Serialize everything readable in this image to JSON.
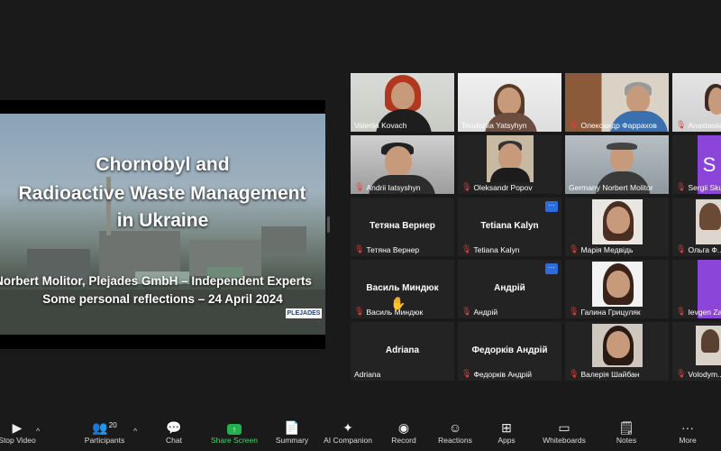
{
  "slide": {
    "title_l1": "Chornobyl and",
    "title_l2": "Radioactive Waste Management",
    "title_l3": "in Ukraine",
    "sub_1": "Norbert Molitor, Plejades GmbH – Independent Experts",
    "sub_2": "Some personal reflections – 24 April 2024",
    "logo": "PLEJADES"
  },
  "participants": [
    {
      "name": "Valeriia Kovach",
      "muted": false,
      "video": true
    },
    {
      "name": "Teodoziia Yatsyhyn",
      "muted": false,
      "video": true
    },
    {
      "name": "Олександр Фаррахов",
      "muted": true,
      "video": true
    },
    {
      "name": "Anastasiia ...",
      "muted": true,
      "video": true
    },
    {
      "name": "Andrii Iatsyshyn",
      "muted": true,
      "video": true
    },
    {
      "name": "Oleksandr Popov",
      "muted": true,
      "video": true
    },
    {
      "name": "Germany Norbert Molitor",
      "muted": false,
      "video": true
    },
    {
      "name": "Sergii Sku...",
      "muted": true,
      "video": false,
      "initial": "S"
    },
    {
      "name": "Тетяна Вернер",
      "muted": true,
      "video": false,
      "center": "Тетяна Вернер"
    },
    {
      "name": "Tetiana Kalyn",
      "muted": true,
      "video": false,
      "center": "Tetiana Kalyn"
    },
    {
      "name": "Марія Медвідь",
      "muted": true,
      "video": true
    },
    {
      "name": "Ольга Ф...",
      "muted": true,
      "video": true
    },
    {
      "name": "Василь Миндюк",
      "muted": true,
      "video": false,
      "center": "Василь Миндюк"
    },
    {
      "name": "Андрій",
      "muted": true,
      "video": false,
      "center": "Андрій"
    },
    {
      "name": "Галина Грицуляк",
      "muted": true,
      "video": true
    },
    {
      "name": "Ievgen Za...",
      "muted": true,
      "video": false
    },
    {
      "name": "Adriana",
      "muted": false,
      "video": false,
      "center": "Adriana"
    },
    {
      "name": "Федорків Андрій",
      "muted": true,
      "video": false,
      "center": "Федорків Андрій"
    },
    {
      "name": "Валерія Шайбан",
      "muted": true,
      "video": true
    },
    {
      "name": "Volodym...",
      "muted": true,
      "video": true
    }
  ],
  "toolbar": {
    "stop_video": "Stop Video",
    "participants": "Participants",
    "participants_count": "20",
    "chat": "Chat",
    "share_screen": "Share Screen",
    "summary": "Summary",
    "ai_companion": "AI Companion",
    "record": "Record",
    "reactions": "Reactions",
    "apps": "Apps",
    "whiteboards": "Whiteboards",
    "notes": "Notes",
    "more": "More"
  },
  "colors": {
    "accent_green": "#22b14c",
    "active_border": "#c9d94a",
    "muted_red": "#e0413b",
    "menu_blue": "#2d6cdf"
  }
}
